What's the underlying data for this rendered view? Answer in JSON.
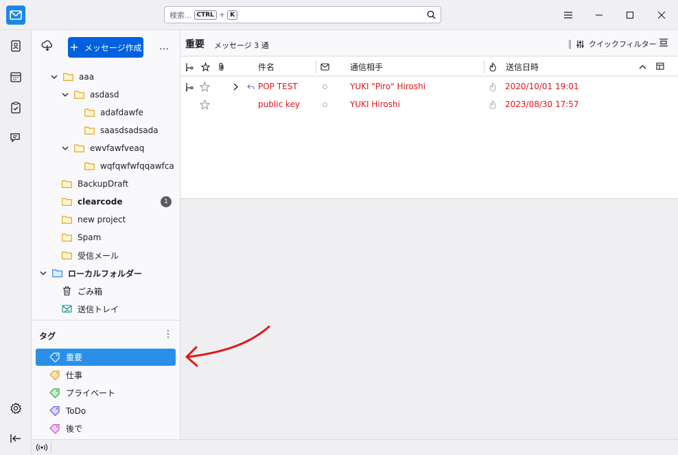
{
  "titlebar": {
    "search_placeholder": "検索...",
    "shortcut_key1": "CTRL",
    "shortcut_plus": "+",
    "shortcut_key2": "K"
  },
  "folder_pane": {
    "compose_label": "メッセージ作成",
    "more_label": "…",
    "folders": [
      {
        "label": "aaa",
        "level": 1,
        "expanded": true
      },
      {
        "label": "asdasd",
        "level": 2,
        "expanded": true
      },
      {
        "label": "adafdawfe",
        "level": 3
      },
      {
        "label": "saasdsadsada",
        "level": 3
      },
      {
        "label": "ewvfawfveaq",
        "level": 2,
        "expanded": true
      },
      {
        "label": "wqfqwfwfqqawfca",
        "level": 3
      },
      {
        "label": "BackupDraft",
        "level": 1
      },
      {
        "label": "clearcode",
        "level": 1,
        "bold": true,
        "unread": "1"
      },
      {
        "label": "new project",
        "level": 1
      },
      {
        "label": "Spam",
        "level": 1
      },
      {
        "label": "受信メール",
        "level": 1
      },
      {
        "label": "ローカルフォルダー",
        "level": 0,
        "bold": true,
        "expanded": true
      },
      {
        "label": "ごみ箱",
        "level": 1,
        "icon": "trash-icon"
      },
      {
        "label": "送信トレイ",
        "level": 1,
        "icon": "outbox-icon"
      }
    ],
    "tags_title": "タグ",
    "tags_more": "⋮",
    "tags": [
      {
        "label": "重要",
        "color": "#ffffff",
        "selected": true
      },
      {
        "label": "仕事",
        "color": "#f5a623"
      },
      {
        "label": "プライベート",
        "color": "#2ea043"
      },
      {
        "label": "ToDo",
        "color": "#5856d6"
      },
      {
        "label": "後で",
        "color": "#c050c0"
      }
    ]
  },
  "thread_pane": {
    "folder_title": "重要",
    "message_count": "メッセージ 3 通",
    "quickfilter_label": "クイックフィルター",
    "columns": {
      "subject": "件名",
      "correspondent": "通信相手",
      "date": "送信日時"
    },
    "rows": [
      {
        "subject": "POP TEST",
        "correspondent": "YUKI \"Piro\" Hiroshi",
        "date": "2020/10/01 19:01",
        "has_thread": true,
        "replied": true
      },
      {
        "subject": "public key",
        "correspondent": "YUKI Hiroshi",
        "date": "2023/08/30 17:57",
        "has_thread": false,
        "replied": false
      }
    ]
  },
  "colors": {
    "accent": "#0061e0",
    "selected_tag": "#2a8fe8",
    "important_text": "#e0131a",
    "annotation_arrow": "#e01818"
  }
}
